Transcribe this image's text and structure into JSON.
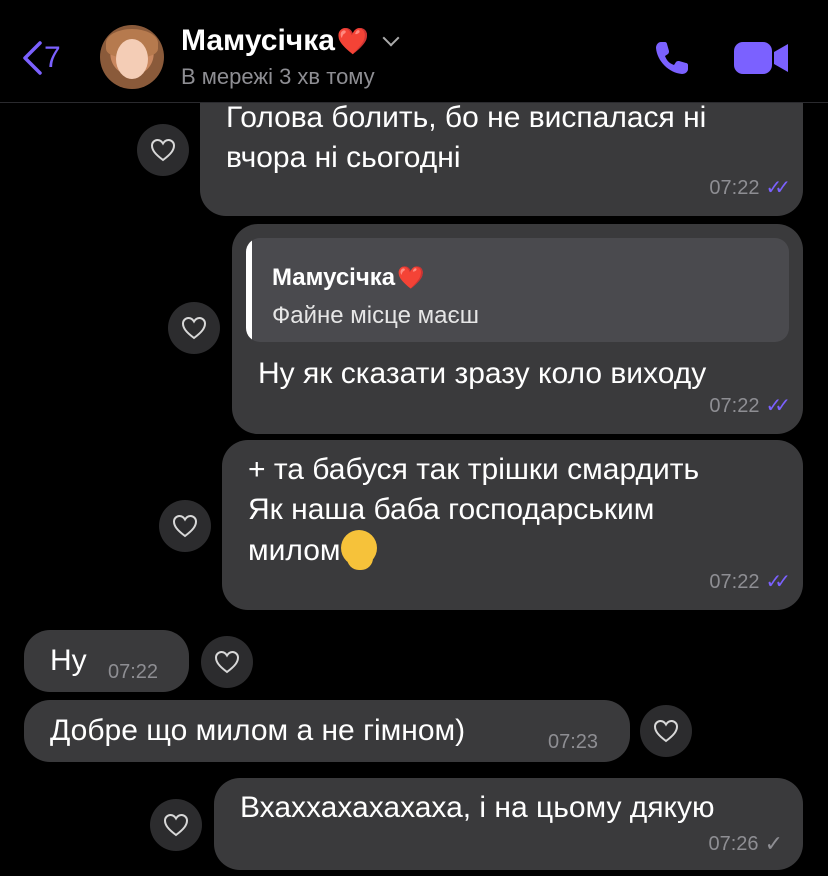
{
  "header": {
    "back_count": "7",
    "contact_name": "Мамусічка",
    "contact_heart": "❤️",
    "status": "В мережі 3 хв тому",
    "accent_color": "#7b61ff"
  },
  "messages": [
    {
      "lines": [
        "Голова болить, бо не виспалася ні",
        "вчора ні сьогодні"
      ],
      "time": "07:22",
      "read": true
    },
    {
      "quote_name": "Мамусічка",
      "quote_heart": "❤️",
      "quote_text": "Файне місце маєш",
      "lines": [
        "Ну як сказати зразу коло виходу"
      ],
      "time": "07:22",
      "read": true
    },
    {
      "lines": [
        "+ та бабуся так трішки смардить",
        "Як наша баба господарським",
        "милом"
      ],
      "emoji": "face-melting-icon",
      "time": "07:22",
      "read": true
    },
    {
      "lines": [
        "Ну"
      ],
      "time": "07:22",
      "incoming": true
    },
    {
      "lines": [
        "Добре що милом а не гімном)"
      ],
      "time": "07:23",
      "incoming": true
    },
    {
      "lines": [
        "Вхаххахахахаха, і на цьому дякую"
      ],
      "time": "07:26",
      "read": false
    }
  ]
}
